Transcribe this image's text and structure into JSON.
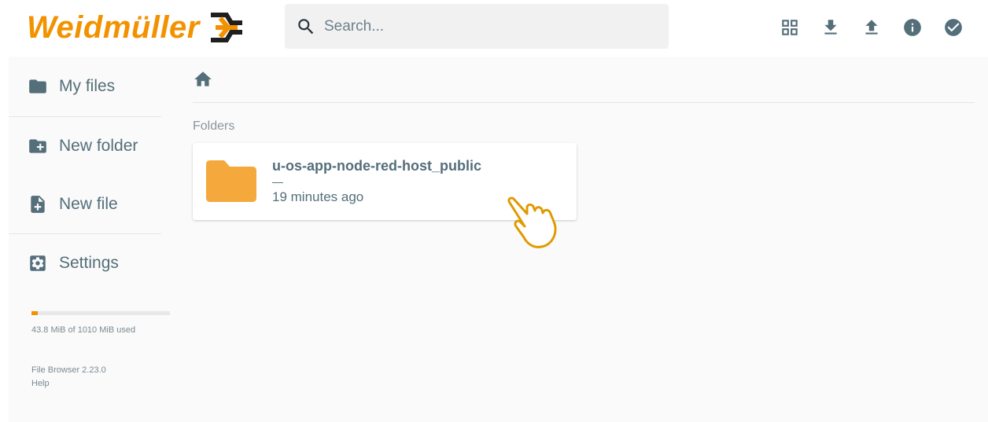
{
  "brand": {
    "name": "Weidmüller",
    "color": "#f39200"
  },
  "search": {
    "placeholder": "Search...",
    "icon": "search-icon"
  },
  "header_actions": [
    {
      "name": "switch-view-icon",
      "title": "Switch view"
    },
    {
      "name": "download-icon",
      "title": "Download"
    },
    {
      "name": "upload-icon",
      "title": "Upload"
    },
    {
      "name": "info-icon",
      "title": "Info"
    },
    {
      "name": "select-multiple-icon",
      "title": "Select multiple"
    }
  ],
  "sidebar": {
    "items": [
      {
        "label": "My files",
        "icon": "folder-icon"
      },
      {
        "label": "New folder",
        "icon": "create-new-folder-icon"
      },
      {
        "label": "New file",
        "icon": "note-add-icon"
      },
      {
        "label": "Settings",
        "icon": "settings-icon"
      }
    ],
    "quota": {
      "text": "43.8 MiB of 1010 MiB used",
      "fraction": 0.043
    },
    "credits": {
      "version": "File Browser 2.23.0",
      "help": "Help"
    }
  },
  "main": {
    "breadcrumb": {
      "icon": "home-icon"
    },
    "section_title": "Folders",
    "folders": [
      {
        "name": "u-os-app-node-red-host_public",
        "size": "—",
        "modified": "19 minutes ago",
        "icon": "folder-icon"
      }
    ]
  },
  "colors": {
    "text": "#546e7a",
    "accent": "#f39200",
    "folder": "#f5a93d"
  }
}
